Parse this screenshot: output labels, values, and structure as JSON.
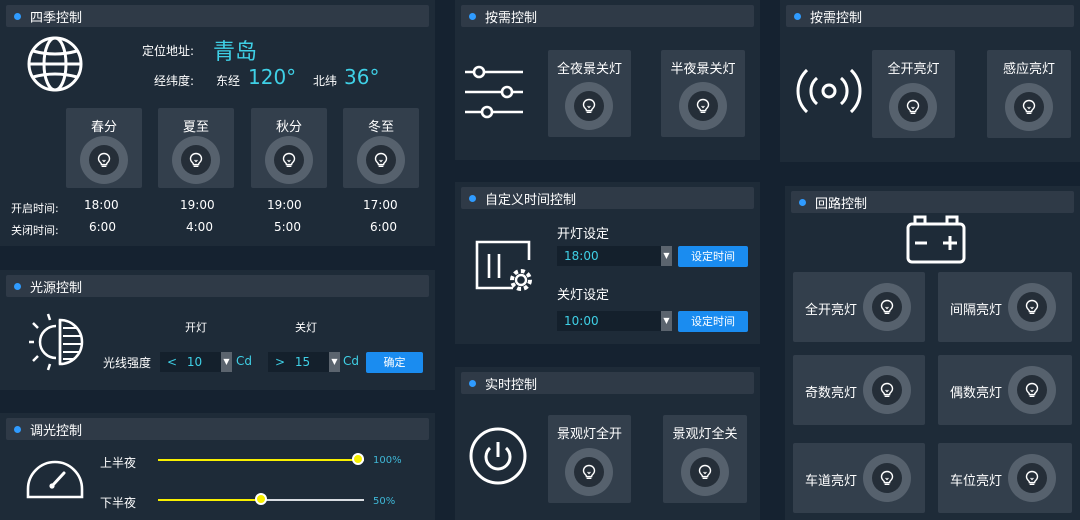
{
  "seasons": {
    "title": "四季控制",
    "location_label": "定位地址:",
    "location_value": "青岛",
    "coord_label": "经纬度:",
    "lon_label": "东经",
    "lon_value": "120°",
    "lat_label": "北纬",
    "lat_value": "36°",
    "open_label": "开启时间:",
    "close_label": "关闭时间:",
    "items": [
      {
        "label": "春分",
        "open": "18:00",
        "close": "6:00"
      },
      {
        "label": "夏至",
        "open": "19:00",
        "close": "4:00"
      },
      {
        "label": "秋分",
        "open": "19:00",
        "close": "5:00"
      },
      {
        "label": "冬至",
        "open": "17:00",
        "close": "6:00"
      }
    ]
  },
  "light_source": {
    "title": "光源控制",
    "on_label": "开灯",
    "off_label": "关灯",
    "intensity_label": "光线强度",
    "on_op": "<",
    "on_value": "10",
    "off_op": ">",
    "off_value": "15",
    "unit": "Cd",
    "confirm": "确定"
  },
  "dimming": {
    "title": "调光控制",
    "first_label": "上半夜",
    "first_value": "100%",
    "first_level": 1.0,
    "second_label": "下半夜",
    "second_value": "50%",
    "second_level": 0.5
  },
  "on_demand_1": {
    "title": "按需控制",
    "cards": [
      "全夜景关灯",
      "半夜景关灯"
    ]
  },
  "custom_time": {
    "title": "自定义时间控制",
    "on_label": "开灯设定",
    "on_value": "18:00",
    "off_label": "关灯设定",
    "off_value": "10:00",
    "set_button": "设定时间"
  },
  "realtime": {
    "title": "实时控制",
    "cards": [
      "景观灯全开",
      "景观灯全关"
    ]
  },
  "on_demand_2": {
    "title": "按需控制",
    "cards": [
      "全开亮灯",
      "感应亮灯"
    ]
  },
  "loop": {
    "title": "回路控制",
    "cards": [
      "全开亮灯",
      "间隔亮灯",
      "奇数亮灯",
      "偶数亮灯",
      "车道亮灯",
      "车位亮灯"
    ]
  },
  "colors": {
    "accent": "#2f9bff",
    "value": "#3fd0e6",
    "button": "#1a8cf0",
    "slider": "#f8f000"
  },
  "icons": {
    "globe": "globe-icon",
    "bulb": "bulb-icon",
    "light_source": "light-source-icon",
    "gauge": "gauge-icon",
    "sliders": "sliders-icon",
    "time_gear": "time-gear-icon",
    "power": "power-icon",
    "signal": "signal-icon",
    "battery": "battery-icon"
  }
}
